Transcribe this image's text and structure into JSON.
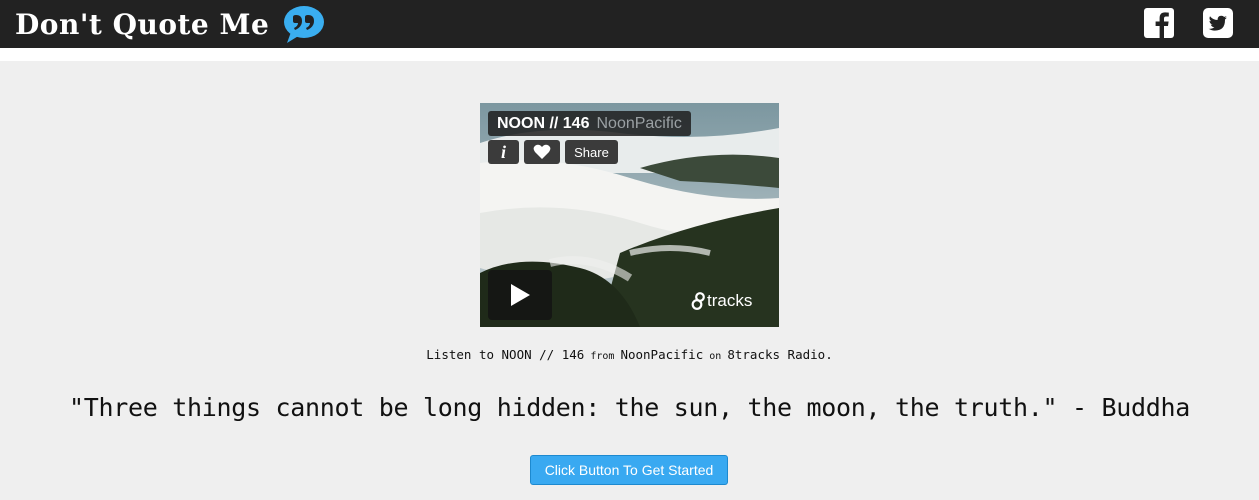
{
  "header": {
    "brand_title": "Don't Quote Me",
    "brand_icon": "speech-bubble-quote-icon",
    "social": [
      {
        "name": "facebook",
        "icon": "facebook-icon"
      },
      {
        "name": "twitter",
        "icon": "twitter-icon"
      }
    ]
  },
  "player": {
    "mix_name": "NOON // 146",
    "mix_user": "NoonPacific",
    "info_label": "i",
    "share_label": "Share",
    "logo_text": "tracks"
  },
  "caption": {
    "listen": "Listen to ",
    "mix_link": "NOON // 146",
    "from": " from ",
    "user_link": "NoonPacific",
    "on": " on ",
    "radio_link": "8tracks Radio",
    "period": "."
  },
  "quote": {
    "text": "\"Three things cannot be long hidden: the sun, the moon, the truth.\" - Buddha"
  },
  "cta": {
    "label": "Click Button To Get Started"
  },
  "colors": {
    "navbar": "#222222",
    "accent_blue": "#39a9f1",
    "quote_icon": "#3aaef0",
    "background": "#efefef"
  }
}
